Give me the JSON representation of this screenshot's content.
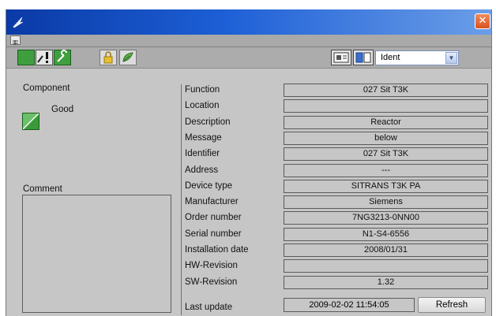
{
  "window": {
    "close_glyph": "✕",
    "title_icon": "app-icon"
  },
  "toolbar": {
    "icons": [
      "status-good-icon",
      "maintenance-icon",
      "wrench-icon",
      "lock-icon",
      "leaf-icon",
      "faceplate-view-icon",
      "device-view-icon"
    ],
    "view_select": {
      "value": "Ident",
      "arrow": "▼"
    }
  },
  "component": {
    "label": "Component",
    "status": "Good"
  },
  "comment": {
    "label": "Comment"
  },
  "fields": [
    {
      "label": "Function",
      "value": "027 Sit T3K"
    },
    {
      "label": "Location",
      "value": ""
    },
    {
      "label": "Description",
      "value": "Reactor"
    },
    {
      "label": "Message",
      "value": "below"
    },
    {
      "label": "Identifier",
      "value": "027 Sit T3K"
    },
    {
      "label": "Address",
      "value": "---"
    },
    {
      "label": "Device type",
      "value": "SITRANS T3K PA"
    },
    {
      "label": "Manufacturer",
      "value": "Siemens"
    },
    {
      "label": "Order number",
      "value": "7NG3213-0NN00"
    },
    {
      "label": "Serial number",
      "value": "N1-S4-6556"
    },
    {
      "label": "Installation date",
      "value": "2008/01/31"
    },
    {
      "label": "HW-Revision",
      "value": ""
    },
    {
      "label": "SW-Revision",
      "value": "1.32"
    }
  ],
  "last_update": {
    "label": "Last update",
    "value": "2009-02-02 11:54:05",
    "refresh_label": "Refresh"
  },
  "colors": {
    "title_dark": "#0a3aa6",
    "title_light": "#6b9ee8",
    "panel": "#c6c6c6",
    "good_green": "#2f8f2f",
    "close_orange": "#d9531e"
  }
}
